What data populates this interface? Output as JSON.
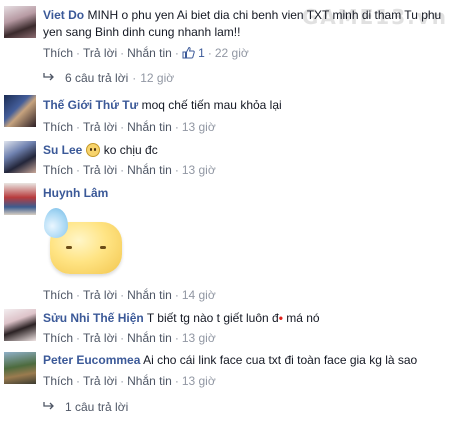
{
  "watermark": "GAME13.vn",
  "actions": {
    "like": "Thích",
    "reply": "Trả lời",
    "message": "Nhắn tin",
    "sep": "·"
  },
  "comments": [
    {
      "author": "Viet Do",
      "text": "MINH o phu yen Ai biet dia chi benh vien TXT minh di tham Tu phu yen sang Binh dinh cung nhanh lam!!",
      "likes": "1",
      "time": "22 giờ",
      "replies": {
        "label": "6 câu trả lời",
        "time": "12 giờ"
      }
    },
    {
      "author": "Thế Giới Thứ Tư",
      "text": "moq chế tiến mau khỏa lại",
      "time": "13 giờ"
    },
    {
      "author": "Su Lee",
      "text": "ko chịu đc",
      "emoji": "smiley-icon",
      "time": "13 giờ"
    },
    {
      "author": "Huynh Lâm",
      "text": "",
      "sticker": "sweat-face-sticker",
      "time": "14 giờ"
    },
    {
      "author": "Sửu Nhi Thế Hiện",
      "text_before": "T biết tg nào t giết luôn đ",
      "text_red": "•",
      "text_after": " má nó",
      "time": "13 giờ"
    },
    {
      "author": "Peter Eucommea",
      "text": "Ai cho cái link face cua txt đi toàn face gia kg là sao",
      "time": "13 giờ",
      "replies": {
        "label": "1 câu trả lời"
      }
    }
  ],
  "colors": {
    "author": "#3b5998",
    "meta": "#9197a3",
    "link": "#4e5665"
  }
}
